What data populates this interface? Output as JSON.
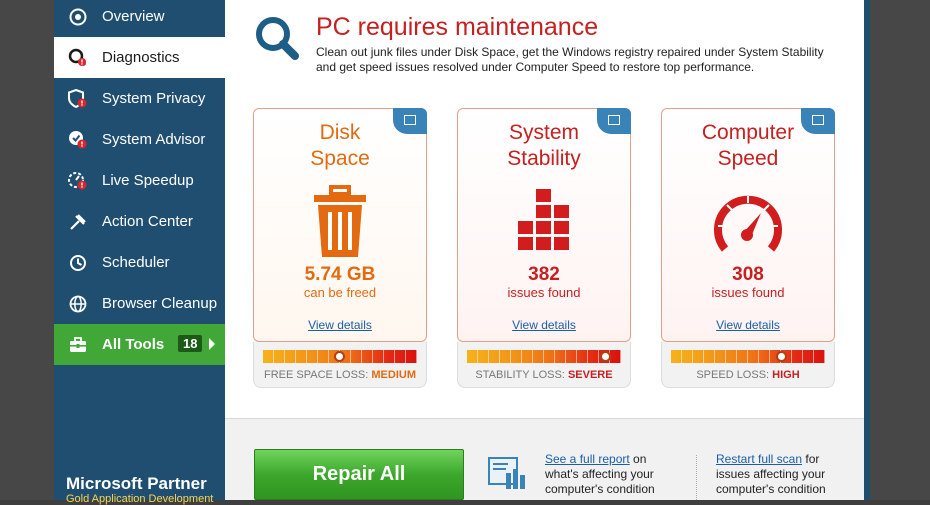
{
  "sidebar": {
    "items": [
      {
        "label": "Overview",
        "icon": "overview-icon"
      },
      {
        "label": "Diagnostics",
        "icon": "diagnostics-icon"
      },
      {
        "label": "System Privacy",
        "icon": "shield-icon"
      },
      {
        "label": "System Advisor",
        "icon": "advisor-icon"
      },
      {
        "label": "Live Speedup",
        "icon": "speedup-icon"
      },
      {
        "label": "Action Center",
        "icon": "action-center-icon"
      },
      {
        "label": "Scheduler",
        "icon": "clock-icon"
      },
      {
        "label": "Browser Cleanup",
        "icon": "globe-icon"
      },
      {
        "label": "All Tools",
        "icon": "toolbox-icon",
        "badge": "18"
      }
    ],
    "partner": "Microsoft Partner",
    "partner_sub": "Gold Application Development"
  },
  "header": {
    "title": "PC requires maintenance",
    "description": "Clean out junk files under Disk Space, get the Windows registry repaired under System Stability and get speed issues resolved under Computer Speed to restore top performance.",
    "icon": "search-icon"
  },
  "cards": [
    {
      "title_line1": "Disk",
      "title_line2": "Space",
      "value": "5.74 GB",
      "sub": "can be freed",
      "link": "View details",
      "loss_label": "FREE SPACE LOSS: ",
      "loss_level": "MEDIUM",
      "color": "#e36a10",
      "icon": "trash-icon",
      "gauge": 0.5
    },
    {
      "title_line1": "System",
      "title_line2": "Stability",
      "value": "382",
      "sub": "issues found",
      "link": "View details",
      "loss_label": "STABILITY LOSS: ",
      "loss_level": "SEVERE",
      "color": "#d11d1d",
      "icon": "blocks-icon",
      "gauge": 0.9
    },
    {
      "title_line1": "Computer",
      "title_line2": "Speed",
      "value": "308",
      "sub": "issues found",
      "link": "View details",
      "loss_label": "SPEED LOSS: ",
      "loss_level": "HIGH",
      "color": "#d11d1d",
      "icon": "speedometer-icon",
      "gauge": 0.72
    }
  ],
  "bottom": {
    "repair_label": "Repair All",
    "report_link": "See a full report",
    "report_text1": " on",
    "report_text2": "what's affecting your",
    "report_text3": "computer's condition",
    "rescan_link": "Restart full scan",
    "rescan_text1": " for",
    "rescan_text2": "issues affecting your",
    "rescan_text3": "computer's condition"
  },
  "colors": {
    "accent": "#1f4e70",
    "danger": "#c62020",
    "success": "#41a737"
  }
}
